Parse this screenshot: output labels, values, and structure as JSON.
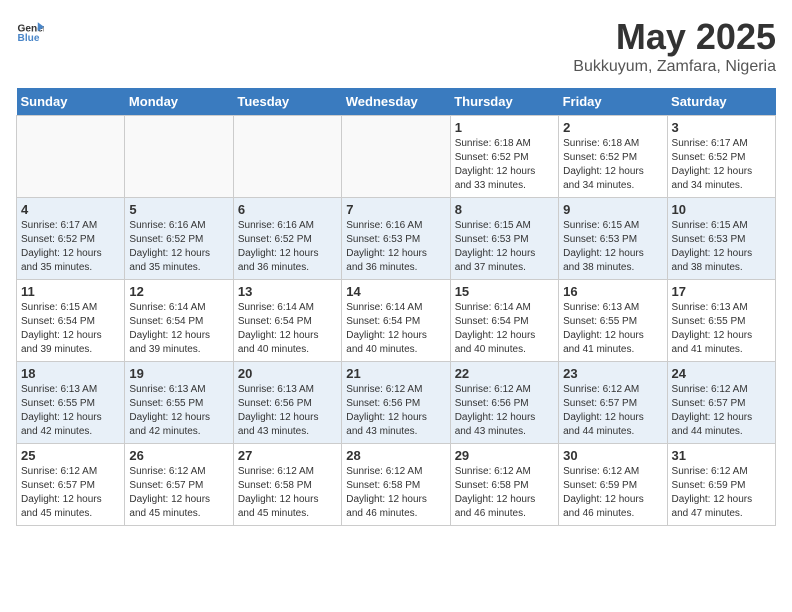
{
  "header": {
    "logo_line1": "General",
    "logo_line2": "Blue",
    "title": "May 2025",
    "subtitle": "Bukkuyum, Zamfara, Nigeria"
  },
  "weekdays": [
    "Sunday",
    "Monday",
    "Tuesday",
    "Wednesday",
    "Thursday",
    "Friday",
    "Saturday"
  ],
  "weeks": [
    [
      {
        "day": "",
        "info": ""
      },
      {
        "day": "",
        "info": ""
      },
      {
        "day": "",
        "info": ""
      },
      {
        "day": "",
        "info": ""
      },
      {
        "day": "1",
        "info": "Sunrise: 6:18 AM\nSunset: 6:52 PM\nDaylight: 12 hours\nand 33 minutes."
      },
      {
        "day": "2",
        "info": "Sunrise: 6:18 AM\nSunset: 6:52 PM\nDaylight: 12 hours\nand 34 minutes."
      },
      {
        "day": "3",
        "info": "Sunrise: 6:17 AM\nSunset: 6:52 PM\nDaylight: 12 hours\nand 34 minutes."
      }
    ],
    [
      {
        "day": "4",
        "info": "Sunrise: 6:17 AM\nSunset: 6:52 PM\nDaylight: 12 hours\nand 35 minutes."
      },
      {
        "day": "5",
        "info": "Sunrise: 6:16 AM\nSunset: 6:52 PM\nDaylight: 12 hours\nand 35 minutes."
      },
      {
        "day": "6",
        "info": "Sunrise: 6:16 AM\nSunset: 6:52 PM\nDaylight: 12 hours\nand 36 minutes."
      },
      {
        "day": "7",
        "info": "Sunrise: 6:16 AM\nSunset: 6:53 PM\nDaylight: 12 hours\nand 36 minutes."
      },
      {
        "day": "8",
        "info": "Sunrise: 6:15 AM\nSunset: 6:53 PM\nDaylight: 12 hours\nand 37 minutes."
      },
      {
        "day": "9",
        "info": "Sunrise: 6:15 AM\nSunset: 6:53 PM\nDaylight: 12 hours\nand 38 minutes."
      },
      {
        "day": "10",
        "info": "Sunrise: 6:15 AM\nSunset: 6:53 PM\nDaylight: 12 hours\nand 38 minutes."
      }
    ],
    [
      {
        "day": "11",
        "info": "Sunrise: 6:15 AM\nSunset: 6:54 PM\nDaylight: 12 hours\nand 39 minutes."
      },
      {
        "day": "12",
        "info": "Sunrise: 6:14 AM\nSunset: 6:54 PM\nDaylight: 12 hours\nand 39 minutes."
      },
      {
        "day": "13",
        "info": "Sunrise: 6:14 AM\nSunset: 6:54 PM\nDaylight: 12 hours\nand 40 minutes."
      },
      {
        "day": "14",
        "info": "Sunrise: 6:14 AM\nSunset: 6:54 PM\nDaylight: 12 hours\nand 40 minutes."
      },
      {
        "day": "15",
        "info": "Sunrise: 6:14 AM\nSunset: 6:54 PM\nDaylight: 12 hours\nand 40 minutes."
      },
      {
        "day": "16",
        "info": "Sunrise: 6:13 AM\nSunset: 6:55 PM\nDaylight: 12 hours\nand 41 minutes."
      },
      {
        "day": "17",
        "info": "Sunrise: 6:13 AM\nSunset: 6:55 PM\nDaylight: 12 hours\nand 41 minutes."
      }
    ],
    [
      {
        "day": "18",
        "info": "Sunrise: 6:13 AM\nSunset: 6:55 PM\nDaylight: 12 hours\nand 42 minutes."
      },
      {
        "day": "19",
        "info": "Sunrise: 6:13 AM\nSunset: 6:55 PM\nDaylight: 12 hours\nand 42 minutes."
      },
      {
        "day": "20",
        "info": "Sunrise: 6:13 AM\nSunset: 6:56 PM\nDaylight: 12 hours\nand 43 minutes."
      },
      {
        "day": "21",
        "info": "Sunrise: 6:12 AM\nSunset: 6:56 PM\nDaylight: 12 hours\nand 43 minutes."
      },
      {
        "day": "22",
        "info": "Sunrise: 6:12 AM\nSunset: 6:56 PM\nDaylight: 12 hours\nand 43 minutes."
      },
      {
        "day": "23",
        "info": "Sunrise: 6:12 AM\nSunset: 6:57 PM\nDaylight: 12 hours\nand 44 minutes."
      },
      {
        "day": "24",
        "info": "Sunrise: 6:12 AM\nSunset: 6:57 PM\nDaylight: 12 hours\nand 44 minutes."
      }
    ],
    [
      {
        "day": "25",
        "info": "Sunrise: 6:12 AM\nSunset: 6:57 PM\nDaylight: 12 hours\nand 45 minutes."
      },
      {
        "day": "26",
        "info": "Sunrise: 6:12 AM\nSunset: 6:57 PM\nDaylight: 12 hours\nand 45 minutes."
      },
      {
        "day": "27",
        "info": "Sunrise: 6:12 AM\nSunset: 6:58 PM\nDaylight: 12 hours\nand 45 minutes."
      },
      {
        "day": "28",
        "info": "Sunrise: 6:12 AM\nSunset: 6:58 PM\nDaylight: 12 hours\nand 46 minutes."
      },
      {
        "day": "29",
        "info": "Sunrise: 6:12 AM\nSunset: 6:58 PM\nDaylight: 12 hours\nand 46 minutes."
      },
      {
        "day": "30",
        "info": "Sunrise: 6:12 AM\nSunset: 6:59 PM\nDaylight: 12 hours\nand 46 minutes."
      },
      {
        "day": "31",
        "info": "Sunrise: 6:12 AM\nSunset: 6:59 PM\nDaylight: 12 hours\nand 47 minutes."
      }
    ]
  ]
}
